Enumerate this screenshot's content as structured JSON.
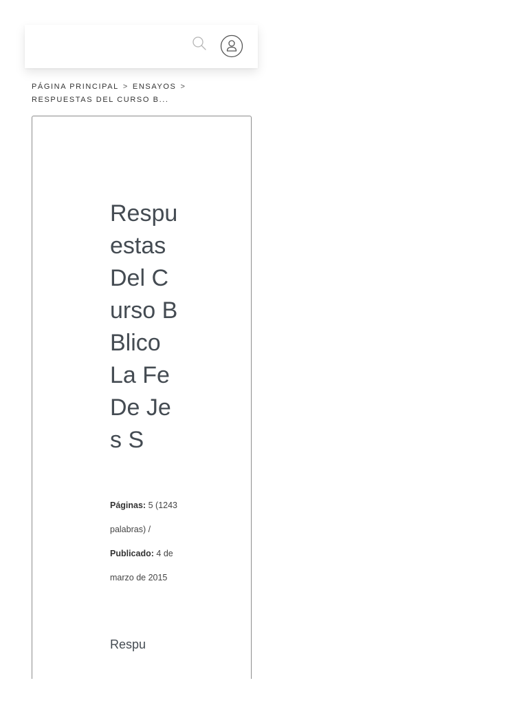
{
  "header": {
    "search_icon": "search-icon",
    "user_icon": "user-icon"
  },
  "breadcrumb": {
    "items": [
      "PÁGINA PRINCIPAL",
      "ENSAYOS",
      "RESPUESTAS DEL CURSO B..."
    ],
    "separator": ">"
  },
  "document": {
    "title": "Respuestas Del Curso B Blico La Fe De Jes S",
    "pages_label": "Páginas:",
    "pages_value": "5",
    "words_value": "(1243 palabras) /",
    "published_label": "Publicado:",
    "published_value": "4 de marzo de 2015",
    "excerpt": "Respu"
  }
}
